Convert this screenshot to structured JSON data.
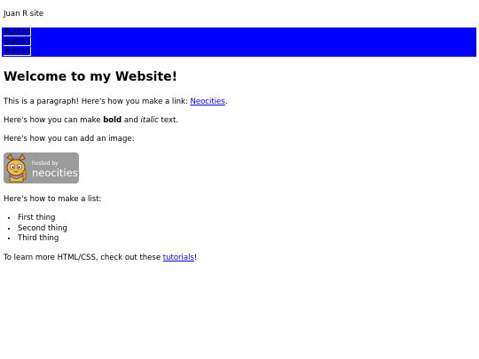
{
  "site": {
    "title": "Juan R site"
  },
  "nav": {
    "buttons": [
      "Button",
      "Button",
      "Button"
    ],
    "color": "#0000ff"
  },
  "main": {
    "heading": "Welcome to my Website!",
    "para1_text": "This is a paragraph! Here's how you make a link: ",
    "para1_link": "Neocities",
    "para1_end": ".",
    "para2_start": "Here's how you can make ",
    "para2_bold": "bold",
    "para2_mid": " and ",
    "para2_italic": "italic",
    "para2_end": " text.",
    "para3": "Here's how you can add an image:",
    "badge": {
      "line1": "hosted by",
      "line2": "neocities"
    },
    "para4": "Here's how to make a list:",
    "list": [
      "First thing",
      "Second thing",
      "Third thing"
    ],
    "para5_start": "To learn more HTML/CSS, check out these ",
    "para5_link": "tutorials",
    "para5_end": "!"
  }
}
